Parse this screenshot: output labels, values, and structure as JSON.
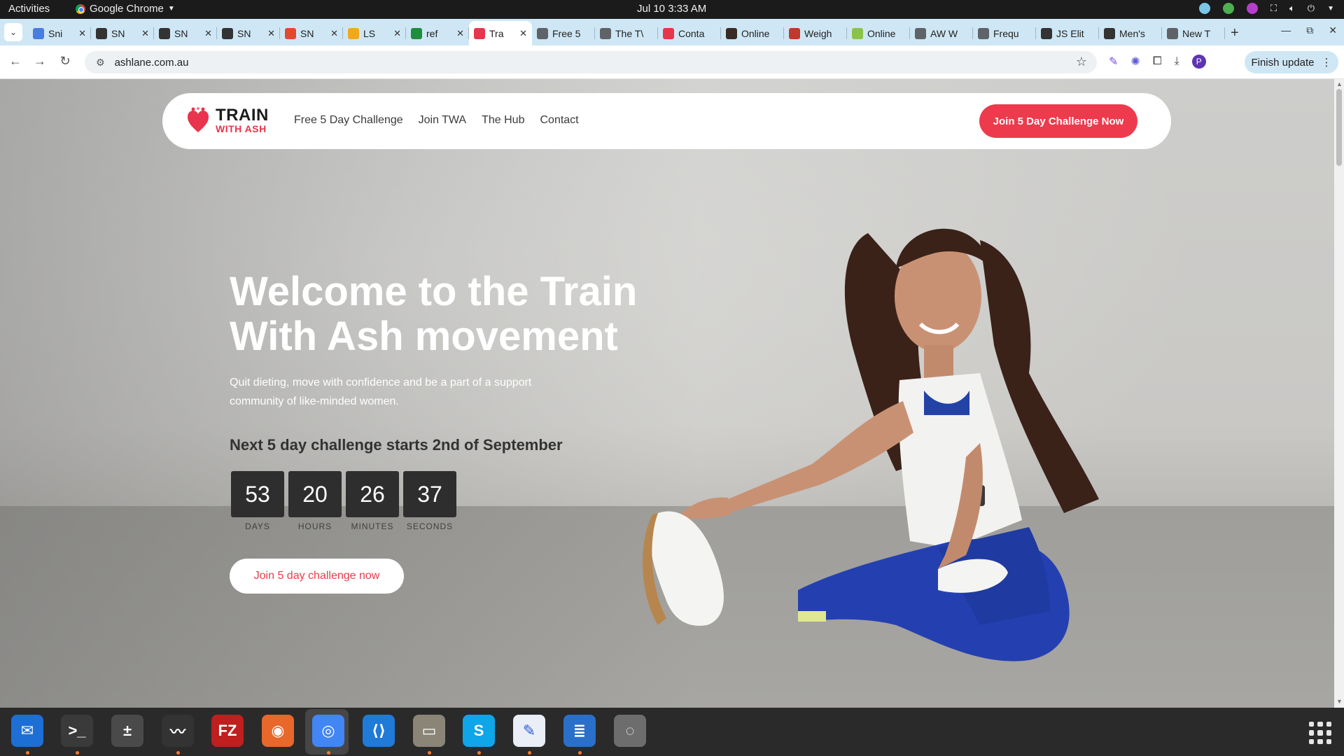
{
  "system": {
    "activities": "Activities",
    "app_name": "Google Chrome",
    "clock": "Jul 10  3:33 AM"
  },
  "tabs": [
    {
      "label": "Sni",
      "color": "#4a7de2"
    },
    {
      "label": "SN",
      "color": "#333333"
    },
    {
      "label": "SN",
      "color": "#333333"
    },
    {
      "label": "SN",
      "color": "#333333"
    },
    {
      "label": "SN",
      "color": "#e2492f"
    },
    {
      "label": "LS",
      "color": "#f2a81d"
    },
    {
      "label": "ref",
      "color": "#1e8e3e"
    },
    {
      "label": "Tra",
      "color": "#e8344c",
      "active": true
    },
    {
      "label": "Free 5",
      "color": "#5f6368"
    },
    {
      "label": "The T\\",
      "color": "#5f6368"
    },
    {
      "label": "Conta",
      "color": "#e8344c"
    },
    {
      "label": "Online",
      "color": "#3a2a24"
    },
    {
      "label": "Weigh",
      "color": "#c0392b"
    },
    {
      "label": "Online",
      "color": "#8bc34a"
    },
    {
      "label": "AW W",
      "color": "#5f6368"
    },
    {
      "label": "Frequ",
      "color": "#5f6368"
    },
    {
      "label": "JS Elit",
      "color": "#333333"
    },
    {
      "label": "Men's",
      "color": "#333333"
    },
    {
      "label": "New T",
      "color": "#5f6368"
    }
  ],
  "browser": {
    "url": "ashlane.com.au",
    "finish_update": "Finish update",
    "profile_initial": "P"
  },
  "site": {
    "logo_line1": "TRAIN",
    "logo_line2": "WITH ASH",
    "nav": [
      "Free 5 Day Challenge",
      "Join TWA",
      "The Hub",
      "Contact"
    ],
    "nav_cta": "Join 5 Day Challenge Now",
    "hero_title": "Welcome to the Train With Ash movement",
    "hero_subtitle": "Quit dieting, move with confidence and be a part of a support community of like-minded women.",
    "challenge_text": "Next 5 day challenge starts 2nd of September",
    "countdown": [
      {
        "value": "53",
        "label": "DAYS"
      },
      {
        "value": "20",
        "label": "HOURS"
      },
      {
        "value": "26",
        "label": "MINUTES"
      },
      {
        "value": "37",
        "label": "SECONDS"
      }
    ],
    "hero_button": "Join 5 day challenge now",
    "accent_color": "#ee3a4d"
  },
  "dock": [
    {
      "name": "thunderbird-icon",
      "color": "#1d6fd6",
      "glyph": "✉",
      "running": true
    },
    {
      "name": "terminal-icon",
      "color": "#3a3a3a",
      "glyph": ">_",
      "running": true
    },
    {
      "name": "calculator-icon",
      "color": "#4a4a4a",
      "glyph": "±",
      "running": false
    },
    {
      "name": "system-monitor-icon",
      "color": "#333333",
      "glyph": "〰",
      "running": true
    },
    {
      "name": "filezilla-icon",
      "color": "#bf1f1f",
      "glyph": "FZ",
      "running": false
    },
    {
      "name": "firefox-icon",
      "color": "#e8672a",
      "glyph": "◉",
      "running": false
    },
    {
      "name": "chrome-icon",
      "color": "#4285f4",
      "glyph": "◎",
      "running": true
    },
    {
      "name": "vscode-icon",
      "color": "#1f7ad8",
      "glyph": "⟨⟩",
      "running": false
    },
    {
      "name": "files-icon",
      "color": "#8a8577",
      "glyph": "▭",
      "running": true
    },
    {
      "name": "skype-icon",
      "color": "#0ea5e9",
      "glyph": "S",
      "running": true
    },
    {
      "name": "text-editor-icon",
      "color": "#e9eef7",
      "glyph": "✎",
      "running": true
    },
    {
      "name": "libreoffice-writer-icon",
      "color": "#2a6fc9",
      "glyph": "≣",
      "running": true
    },
    {
      "name": "disk-icon",
      "color": "#6d6d6d",
      "glyph": "◌",
      "running": false
    }
  ]
}
